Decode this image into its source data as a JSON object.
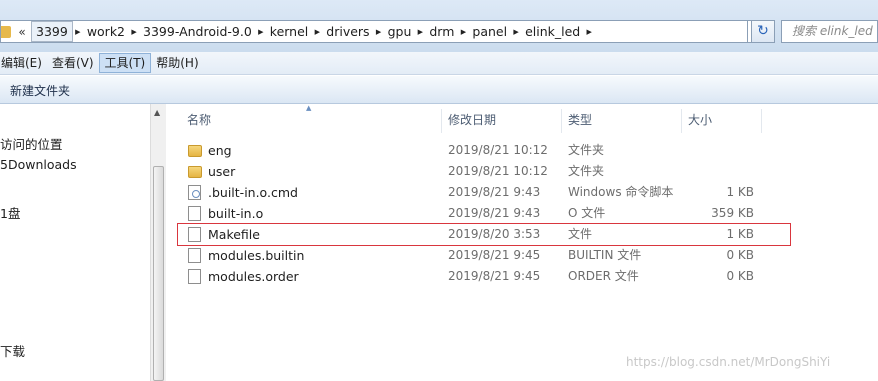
{
  "address_bar": {
    "overflow_label": "«",
    "crumbs": [
      "3399",
      "work2",
      "3399-Android-9.0",
      "kernel",
      "drivers",
      "gpu",
      "drm",
      "panel",
      "elink_led"
    ],
    "dropdown": "▼",
    "refresh": "↻"
  },
  "search": {
    "placeholder": "搜索 elink_led"
  },
  "menu": {
    "items": [
      "编辑(E)",
      "查看(V)",
      "工具(T)",
      "帮助(H)"
    ],
    "active_index": 2
  },
  "toolbar": {
    "new_folder_label": "新建文件夹"
  },
  "nav_pane": {
    "items": [
      "访问的位置",
      "5Downloads",
      "1盘",
      "下载"
    ]
  },
  "columns": {
    "name": "名称",
    "date": "修改日期",
    "type": "类型",
    "size": "大小"
  },
  "files": [
    {
      "name": "eng",
      "date": "2019/8/21 10:12",
      "type": "文件夹",
      "size": "",
      "icon": "folder-icon"
    },
    {
      "name": "user",
      "date": "2019/8/21 10:12",
      "type": "文件夹",
      "size": "",
      "icon": "folder-icon"
    },
    {
      "name": ".built-in.o.cmd",
      "date": "2019/8/21 9:43",
      "type": "Windows 命令脚本",
      "size": "1 KB",
      "icon": "cmd-script-icon"
    },
    {
      "name": "built-in.o",
      "date": "2019/8/21 9:43",
      "type": "O 文件",
      "size": "359 KB",
      "icon": "file-icon"
    },
    {
      "name": "Makefile",
      "date": "2019/8/20 3:53",
      "type": "文件",
      "size": "1 KB",
      "icon": "file-icon"
    },
    {
      "name": "modules.builtin",
      "date": "2019/8/21 9:45",
      "type": "BUILTIN 文件",
      "size": "0 KB",
      "icon": "file-icon"
    },
    {
      "name": "modules.order",
      "date": "2019/8/21 9:45",
      "type": "ORDER 文件",
      "size": "0 KB",
      "icon": "file-icon"
    }
  ],
  "highlighted_file": "Makefile",
  "colors": {
    "highlight_border": "#d9363e",
    "window_chrome": "#dde9f6"
  },
  "watermark": "https://blog.csdn.net/MrDongShiYi"
}
